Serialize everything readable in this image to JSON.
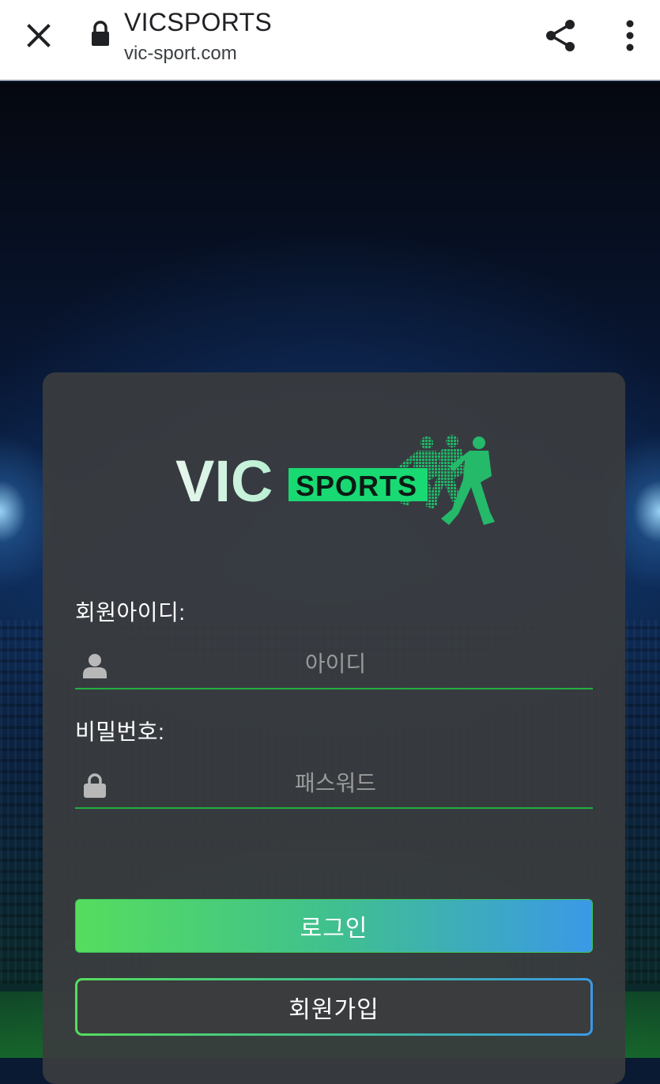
{
  "browser": {
    "title": "VICSPORTS",
    "url": "vic-sport.com",
    "icons": {
      "close": "close-icon",
      "lock": "lock-icon",
      "share": "share-icon",
      "more": "more-vert-icon"
    }
  },
  "login": {
    "logo": {
      "text_vic": "VIC",
      "text_sports": "SPORTS"
    },
    "id_label": "회원아이디:",
    "id_placeholder": "아이디",
    "pw_label": "비밀번호:",
    "pw_placeholder": "패스워드",
    "login_button": "로그인",
    "signup_button": "회원가입"
  },
  "colors": {
    "accent_green": "#20b040",
    "gradient_start": "#55dd5e",
    "gradient_end": "#3b99e6",
    "card_bg": "#3a3c3e"
  }
}
